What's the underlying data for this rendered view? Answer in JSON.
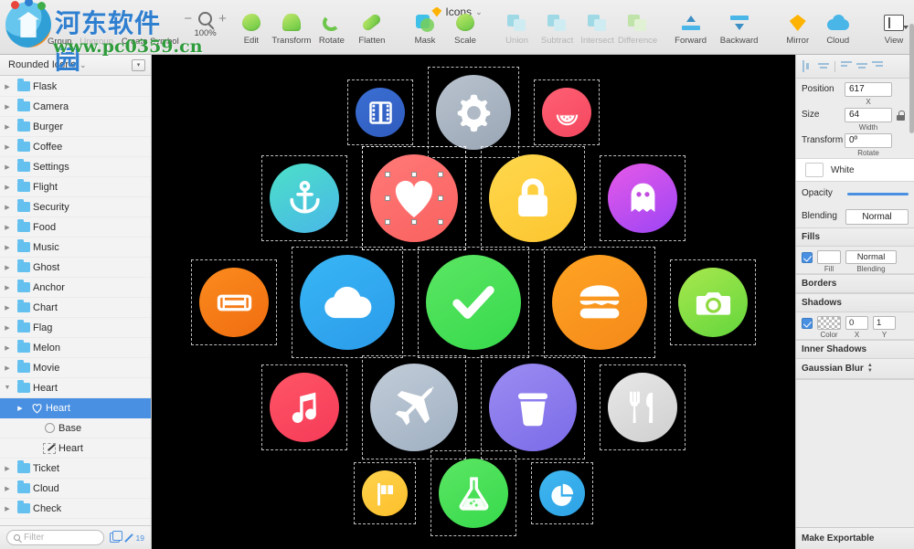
{
  "window": {
    "document_title": "Icons",
    "zoom_level": "100%"
  },
  "watermark": {
    "site_name_cn": "河东软件园",
    "site_url": "www.pc0359.cn",
    "logo_icon": "site-logo-icon"
  },
  "toolbar": {
    "left_actions": [
      {
        "label": "Group",
        "enabled": true
      },
      {
        "label": "Ungroup",
        "enabled": false
      },
      {
        "label": "Create Symbol",
        "enabled": true
      }
    ],
    "zoom": {
      "minus": "−",
      "plus": "+",
      "magnifier_icon": "magnifier-icon",
      "percent": "100%"
    },
    "items": [
      {
        "label": "Edit",
        "icon": "edit-shape-icon",
        "dim": false
      },
      {
        "label": "Transform",
        "icon": "transform-shape-icon",
        "dim": false
      },
      {
        "label": "Rotate",
        "icon": "rotate-icon",
        "dim": false
      },
      {
        "label": "Flatten",
        "icon": "flatten-icon",
        "dim": false
      },
      {
        "label": "Mask",
        "icon": "mask-icon",
        "dim": false
      },
      {
        "label": "Scale",
        "icon": "scale-icon",
        "dim": false
      },
      {
        "label": "Union",
        "icon": "union-icon",
        "dim": true
      },
      {
        "label": "Subtract",
        "icon": "subtract-icon",
        "dim": true
      },
      {
        "label": "Intersect",
        "icon": "intersect-icon",
        "dim": true
      },
      {
        "label": "Difference",
        "icon": "difference-icon",
        "dim": true
      },
      {
        "label": "Forward",
        "icon": "move-forward-icon",
        "dim": false
      },
      {
        "label": "Backward",
        "icon": "move-backward-icon",
        "dim": false
      },
      {
        "label": "Mirror",
        "icon": "mirror-diamond-icon",
        "dim": false
      },
      {
        "label": "Cloud",
        "icon": "cloud-upload-icon",
        "dim": false
      },
      {
        "label": "View",
        "icon": "view-layout-icon",
        "dim": false
      }
    ]
  },
  "sidebar": {
    "page_selector": "Rounded Icons",
    "page_menu_icon": "page-options-icon",
    "layers": [
      {
        "name": "Flask",
        "icon": "folder-icon",
        "indent": 0,
        "disclosure": "closed",
        "selected": false
      },
      {
        "name": "Camera",
        "icon": "folder-icon",
        "indent": 0,
        "disclosure": "closed",
        "selected": false
      },
      {
        "name": "Burger",
        "icon": "folder-icon",
        "indent": 0,
        "disclosure": "closed",
        "selected": false
      },
      {
        "name": "Coffee",
        "icon": "folder-icon",
        "indent": 0,
        "disclosure": "closed",
        "selected": false
      },
      {
        "name": "Settings",
        "icon": "folder-icon",
        "indent": 0,
        "disclosure": "closed",
        "selected": false
      },
      {
        "name": "Flight",
        "icon": "folder-icon",
        "indent": 0,
        "disclosure": "closed",
        "selected": false
      },
      {
        "name": "Security",
        "icon": "folder-icon",
        "indent": 0,
        "disclosure": "closed",
        "selected": false
      },
      {
        "name": "Food",
        "icon": "folder-icon",
        "indent": 0,
        "disclosure": "closed",
        "selected": false
      },
      {
        "name": "Music",
        "icon": "folder-icon",
        "indent": 0,
        "disclosure": "closed",
        "selected": false
      },
      {
        "name": "Ghost",
        "icon": "folder-icon",
        "indent": 0,
        "disclosure": "closed",
        "selected": false
      },
      {
        "name": "Anchor",
        "icon": "folder-icon",
        "indent": 0,
        "disclosure": "closed",
        "selected": false
      },
      {
        "name": "Chart",
        "icon": "folder-icon",
        "indent": 0,
        "disclosure": "closed",
        "selected": false
      },
      {
        "name": "Flag",
        "icon": "folder-icon",
        "indent": 0,
        "disclosure": "closed",
        "selected": false
      },
      {
        "name": "Melon",
        "icon": "folder-icon",
        "indent": 0,
        "disclosure": "closed",
        "selected": false
      },
      {
        "name": "Movie",
        "icon": "folder-icon",
        "indent": 0,
        "disclosure": "closed",
        "selected": false
      },
      {
        "name": "Heart",
        "icon": "folder-icon",
        "indent": 0,
        "disclosure": "open",
        "selected": false
      },
      {
        "name": "Heart",
        "icon": "heart-shape-icon",
        "indent": 1,
        "disclosure": "closed",
        "selected": true
      },
      {
        "name": "Base",
        "icon": "oval-shape-icon",
        "indent": 2,
        "disclosure": "none",
        "selected": false
      },
      {
        "name": "Heart",
        "icon": "path-shape-icon",
        "indent": 2,
        "disclosure": "none",
        "selected": false
      },
      {
        "name": "Ticket",
        "icon": "folder-icon",
        "indent": 0,
        "disclosure": "closed",
        "selected": false
      },
      {
        "name": "Cloud",
        "icon": "folder-icon",
        "indent": 0,
        "disclosure": "closed",
        "selected": false
      },
      {
        "name": "Check",
        "icon": "folder-icon",
        "indent": 0,
        "disclosure": "closed",
        "selected": false
      }
    ],
    "filter": {
      "placeholder": "Filter",
      "search_icon": "search-icon",
      "copies_icon": "duplicate-icon",
      "pen_icon": "pen-icon",
      "count": "19"
    }
  },
  "canvas": {
    "background_color": "#000000",
    "rows": [
      {
        "icons": [
          {
            "name": "Movie",
            "icon": "movie-film-icon",
            "color_a": "#3b6fd4",
            "color_b": "#2f5bbd",
            "size": 54,
            "selected": true
          },
          {
            "name": "Settings",
            "icon": "gear-icon",
            "color_a": "#b9c3cf",
            "color_b": "#9aa6b5",
            "size": 82,
            "selected": true
          },
          {
            "name": "Melon",
            "icon": "watermelon-icon",
            "color_a": "#ff6073",
            "color_b": "#f4475f",
            "size": 54,
            "selected": true
          }
        ]
      },
      {
        "icons": [
          {
            "name": "Anchor",
            "icon": "anchor-icon",
            "color_a": "#4ce0c8",
            "color_b": "#49b7e8",
            "size": 76,
            "selected": true
          },
          {
            "name": "Heart",
            "icon": "heart-icon",
            "color_a": "#ff7a78",
            "color_b": "#f9615f",
            "size": 96,
            "selected": true,
            "handles": true
          },
          {
            "name": "Security",
            "icon": "lock-icon",
            "color_a": "#ffd84d",
            "color_b": "#fcc52f",
            "size": 96,
            "selected": true
          },
          {
            "name": "Ghost",
            "icon": "ghost-icon",
            "color_a": "#e659e8",
            "color_b": "#9c45f5",
            "size": 76,
            "selected": true
          }
        ]
      },
      {
        "icons": [
          {
            "name": "Ticket",
            "icon": "ticket-icon",
            "color_a": "#fb8b1e",
            "color_b": "#f06d10",
            "size": 76,
            "selected": true
          },
          {
            "name": "Cloud",
            "icon": "cloud-icon",
            "color_a": "#38b6f5",
            "color_b": "#2b9bea",
            "size": 104,
            "selected": true
          },
          {
            "name": "Check",
            "icon": "check-icon",
            "color_a": "#5ce663",
            "color_b": "#36d94c",
            "size": 104,
            "selected": true
          },
          {
            "name": "Burger",
            "icon": "burger-icon",
            "color_a": "#ffa423",
            "color_b": "#f4891a",
            "size": 104,
            "selected": true
          },
          {
            "name": "Camera",
            "icon": "camera-icon",
            "color_a": "#a8e84e",
            "color_b": "#63d63c",
            "size": 76,
            "selected": true
          }
        ]
      },
      {
        "icons": [
          {
            "name": "Music",
            "icon": "music-note-icon",
            "color_a": "#ff5566",
            "color_b": "#f53b58",
            "size": 76,
            "selected": true
          },
          {
            "name": "Flight",
            "icon": "airplane-icon",
            "color_a": "#c2ccd8",
            "color_b": "#9fb0c2",
            "size": 96,
            "selected": true
          },
          {
            "name": "Coffee",
            "icon": "coffee-cup-icon",
            "color_a": "#9b8cf2",
            "color_b": "#7b6be8",
            "size": 96,
            "selected": true
          },
          {
            "name": "Food",
            "icon": "cutlery-icon",
            "color_a": "#e8e8e8",
            "color_b": "#cfcfcf",
            "size": 76,
            "selected": true
          }
        ]
      },
      {
        "icons": [
          {
            "name": "Flag",
            "icon": "flag-icon",
            "color_a": "#ffd34d",
            "color_b": "#fcbf2b",
            "size": 50,
            "selected": true
          },
          {
            "name": "Flask",
            "icon": "flask-icon",
            "color_a": "#5ce663",
            "color_b": "#36d94c",
            "size": 76,
            "selected": true
          },
          {
            "name": "Chart",
            "icon": "pie-chart-icon",
            "color_a": "#3fb8f0",
            "color_b": "#2ea2e6",
            "size": 50,
            "selected": true
          }
        ]
      }
    ]
  },
  "inspector": {
    "alignment_icons": [
      "align-left-icon",
      "align-center-horizontal-icon",
      "align-top-icon",
      "align-middle-vertical-icon",
      "align-bottom-icon"
    ],
    "position": {
      "label": "Position",
      "value": "617",
      "sublabel": "X"
    },
    "size": {
      "label": "Size",
      "value": "64",
      "sublabel": "Width",
      "lock_icon": "aspect-lock-icon"
    },
    "transform": {
      "label": "Transform",
      "value": "0º",
      "sublabel": "Rotate"
    },
    "style_name": "White",
    "opacity": {
      "label": "Opacity",
      "slider_color": "#4a90e2"
    },
    "blending": {
      "label": "Blending",
      "value": "Normal"
    },
    "fills": {
      "title": "Fills",
      "enabled": true,
      "fill_sublabel": "Fill",
      "blending_value": "Normal",
      "blending_sublabel": "Blending"
    },
    "borders": {
      "title": "Borders"
    },
    "shadows": {
      "title": "Shadows",
      "enabled": true,
      "color_sublabel": "Color",
      "x_value": "0",
      "x_sublabel": "X",
      "y_value": "1",
      "y_sublabel": "Y"
    },
    "inner_shadows": {
      "title": "Inner Shadows"
    },
    "blur": {
      "title": "Gaussian Blur",
      "stepper_icon": "stepper-icon"
    },
    "export": {
      "title": "Make Exportable"
    }
  }
}
